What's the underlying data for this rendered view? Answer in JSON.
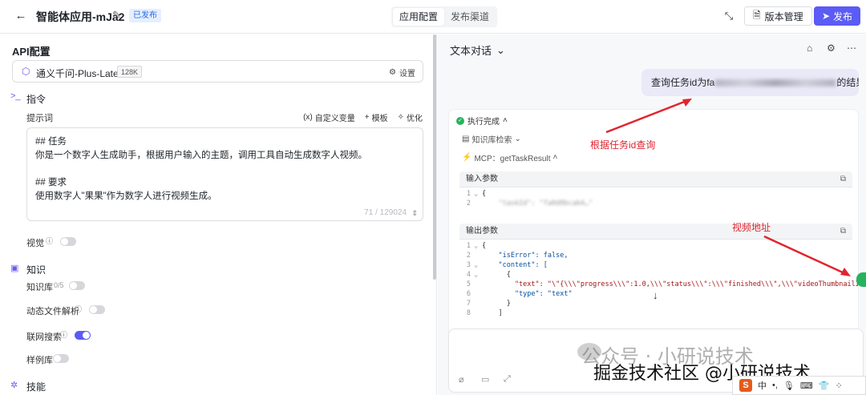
{
  "topbar": {
    "title": "智能体应用-mJa2",
    "status_badge": "已发布",
    "tabs": [
      "应用配置",
      "发布渠道"
    ],
    "version_label": "版本管理",
    "publish_label": "发布"
  },
  "left": {
    "api_section": "API配置",
    "model": {
      "name": "通义千问-Plus-Latest",
      "context": "128K",
      "settings_label": "设置"
    },
    "instruction_section": "指令",
    "prompt_label": "提示词",
    "prompt_tools": {
      "custom_var": "自定义变量",
      "template": "模板",
      "optimize": "优化"
    },
    "prompt_lines": [
      "## 任务",
      "你是一个数字人生成助手，根据用户输入的主题，调用工具自动生成数字人视频。",
      "",
      "## 要求",
      "使用数字人\"果果\"作为数字人进行视频生成。"
    ],
    "prompt_count": "71 / 129024",
    "vision_label": "视觉",
    "knowledge_section": "知识",
    "kb_label": "知识库",
    "kb_count": "0/5",
    "dynamic_file_label": "动态文件解析",
    "web_search_label": "联网搜索",
    "example_label": "样例库",
    "skills_section": "技能"
  },
  "right": {
    "chat_mode": "文本对话",
    "user_msg_prefix": "查询任务id为fa",
    "user_msg_suffix": "的结果",
    "exec_status": "执行完成",
    "kb_search": "知识库检索",
    "mcp_call": "MCP：getTaskResult",
    "input_params_title": "输入参数",
    "input_lines": [
      {
        "n": "1",
        "text": "{"
      },
      {
        "n": "2",
        "text": "    \"taskId\": \"fa0d8bcab4…\""
      }
    ],
    "output_params_title": "输出参数",
    "output_lines": [
      {
        "n": "1",
        "text": "{"
      },
      {
        "n": "2",
        "text": "    \"isError\": false,"
      },
      {
        "n": "3",
        "text": "    \"content\": ["
      },
      {
        "n": "4",
        "text": "      {"
      },
      {
        "n": "5",
        "text": "        \"text\": \"\\\"{\\\\\\\"progress\\\\\\\":1.0,\\\\\\\"status\\\\\\\":\\\\\\\"finished\\\\\\\",\\\\\\\"videoThumbnailImageUrl"
      },
      {
        "n": "6",
        "text": "        \"type\": \"text\""
      },
      {
        "n": "7",
        "text": "      }"
      },
      {
        "n": "8",
        "text": "    ]"
      }
    ],
    "annotation_query": "根据任务id查询",
    "annotation_video": "视频地址"
  },
  "watermarks": {
    "wechat": "公众号 · 小研说技术",
    "juejin": "掘金技术社区 @小研说技术"
  },
  "ime": {
    "logo": "S",
    "mode": "中"
  },
  "colors": {
    "accent": "#5b5bf5",
    "success": "#27b35e",
    "annotation": "#e0252f"
  }
}
